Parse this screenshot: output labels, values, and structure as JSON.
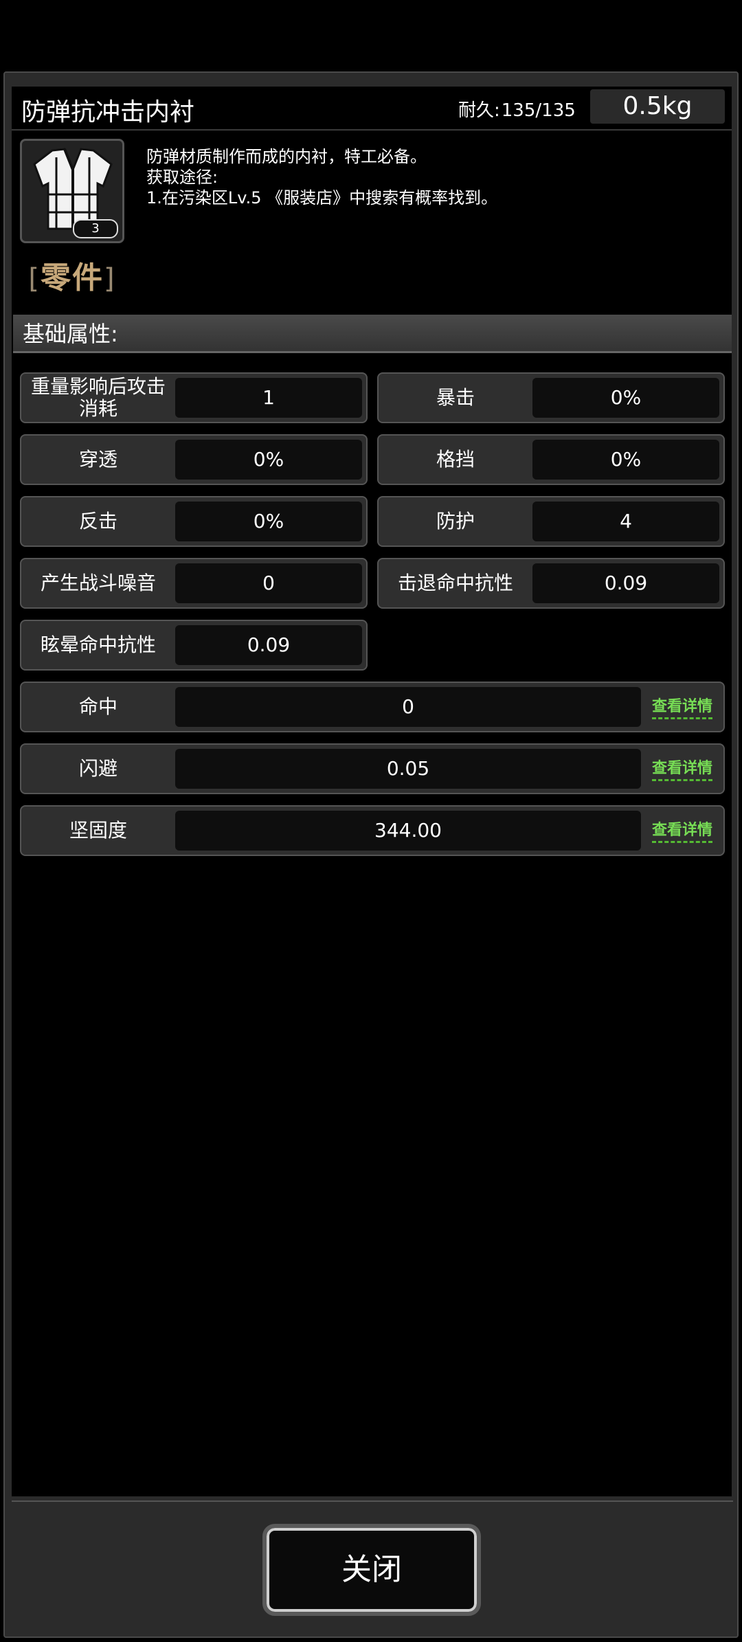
{
  "item": {
    "title": "防弹抗冲击内衬",
    "durability_label": "耐久:",
    "durability_value": "135/135",
    "weight": "0.5kg",
    "count": "3",
    "category": "零件",
    "category_open": "[",
    "category_close": "]",
    "description": [
      "防弹材质制作而成的内衬，特工必备。",
      "获取途径:",
      "1.在污染区Lv.5 《服装店》中搜索有概率找到。"
    ]
  },
  "section_title": "基础属性:",
  "stats": {
    "row1_left": {
      "label": "重量影响后攻击消耗",
      "value": "1"
    },
    "row1_right": {
      "label": "暴击",
      "value": "0%"
    },
    "row2_left": {
      "label": "穿透",
      "value": "0%"
    },
    "row2_right": {
      "label": "格挡",
      "value": "0%"
    },
    "row3_left": {
      "label": "反击",
      "value": "0%"
    },
    "row3_right": {
      "label": "防护",
      "value": "4"
    },
    "row4_left": {
      "label": "产生战斗噪音",
      "value": "0"
    },
    "row4_right": {
      "label": "击退命中抗性",
      "value": "0.09"
    },
    "row5_left": {
      "label": "眩晕命中抗性",
      "value": "0.09"
    }
  },
  "wide_stats": [
    {
      "label": "命中",
      "value": "0",
      "link": "查看详情"
    },
    {
      "label": "闪避",
      "value": "0.05",
      "link": "查看详情"
    },
    {
      "label": "坚固度",
      "value": "344.00",
      "link": "查看详情"
    }
  ],
  "close_label": "关闭",
  "colors": {
    "category": "#c7a87a",
    "detail_link": "#77dd55",
    "panel_bg": "#2b2b2b"
  }
}
